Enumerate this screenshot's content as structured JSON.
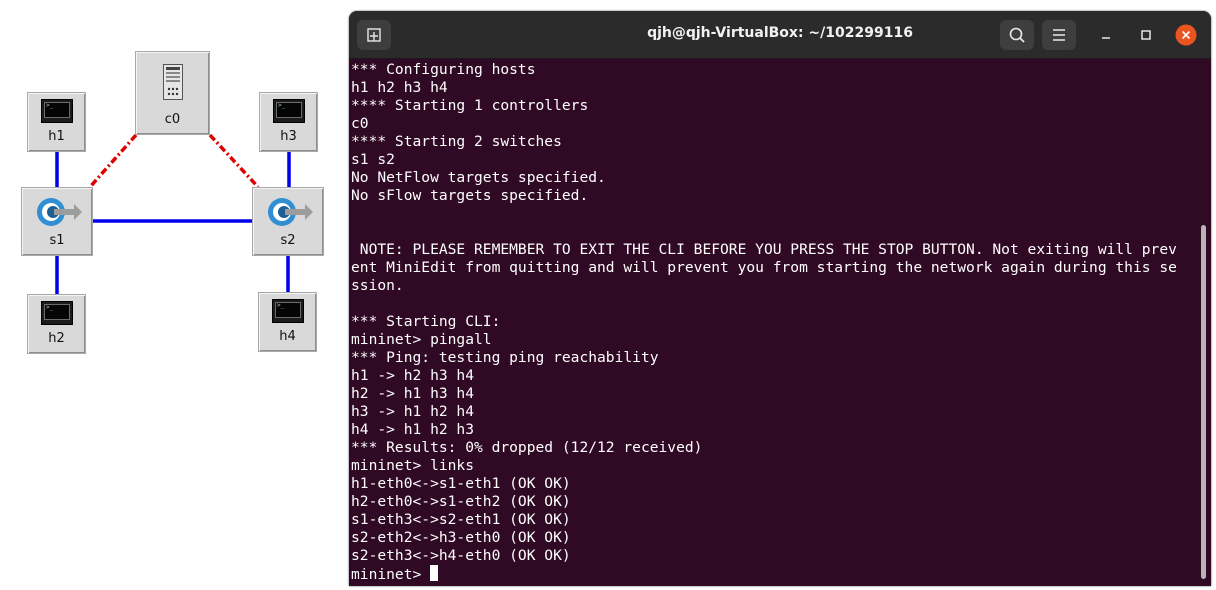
{
  "miniedit": {
    "nodes": {
      "h1": "h1",
      "h2": "h2",
      "h3": "h3",
      "h4": "h4",
      "s1": "s1",
      "s2": "s2",
      "c0": "c0"
    },
    "colors": {
      "data_link": "#0000ee",
      "control_link": "#dd0000"
    }
  },
  "terminal": {
    "title": "qjh@qjh-VirtualBox: ~/102299116",
    "lines": [
      "*** Configuring hosts",
      "h1 h2 h3 h4",
      "**** Starting 1 controllers",
      "c0",
      "**** Starting 2 switches",
      "s1 s2",
      "No NetFlow targets specified.",
      "No sFlow targets specified.",
      "",
      "",
      " NOTE: PLEASE REMEMBER TO EXIT THE CLI BEFORE YOU PRESS THE STOP BUTTON. Not exiting will prev",
      "ent MiniEdit from quitting and will prevent you from starting the network again during this se",
      "ssion.",
      "",
      "*** Starting CLI:",
      "mininet> pingall",
      "*** Ping: testing ping reachability",
      "h1 -> h2 h3 h4",
      "h2 -> h1 h3 h4",
      "h3 -> h1 h2 h4",
      "h4 -> h1 h2 h3",
      "*** Results: 0% dropped (12/12 received)",
      "mininet> links",
      "h1-eth0<->s1-eth1 (OK OK)",
      "h2-eth0<->s1-eth2 (OK OK)",
      "s1-eth3<->s2-eth1 (OK OK)",
      "s2-eth2<->h3-eth0 (OK OK)",
      "s2-eth3<->h4-eth0 (OK OK)"
    ],
    "prompt": "mininet> ",
    "colors": {
      "background": "#300a24",
      "titlebar": "#2b2b2b",
      "text": "#ffffff",
      "close_button": "#e95420"
    },
    "icons": [
      "new-tab-icon",
      "search-icon",
      "hamburger-menu-icon",
      "minimize-icon",
      "maximize-icon",
      "close-icon"
    ]
  }
}
